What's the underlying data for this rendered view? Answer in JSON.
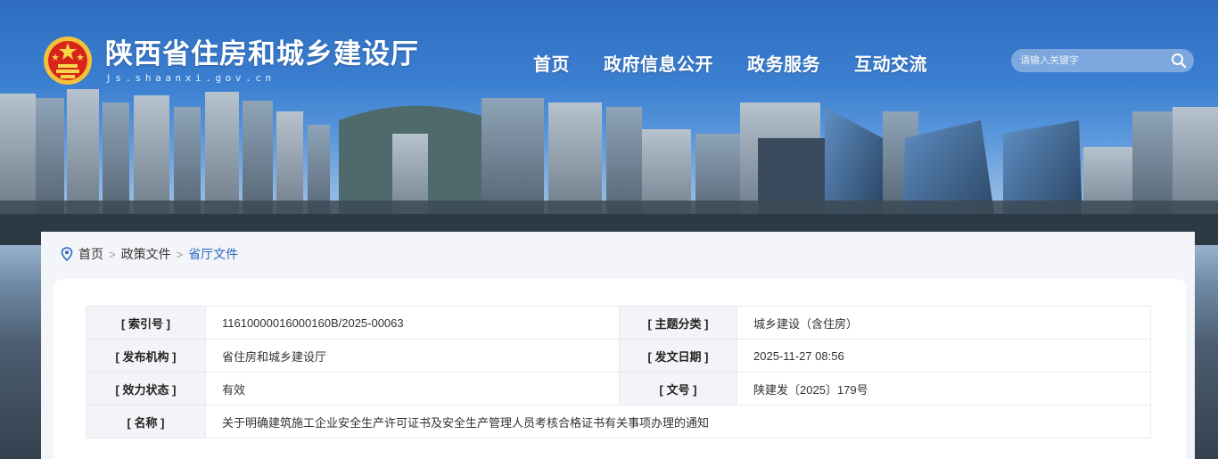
{
  "header": {
    "title_cn": "陕西省住房和城乡建设厅",
    "title_en": "js.shaanxi.gov.cn",
    "emblem_icon": "national-emblem-icon"
  },
  "nav": {
    "items": [
      {
        "label": "首页"
      },
      {
        "label": "政府信息公开"
      },
      {
        "label": "政务服务"
      },
      {
        "label": "互动交流"
      }
    ]
  },
  "search": {
    "placeholder": "请输入关键字",
    "icon": "search-icon"
  },
  "breadcrumb": {
    "icon": "location-pin-icon",
    "items": [
      "首页",
      "政策文件",
      "省厅文件"
    ],
    "separator": ">"
  },
  "document_info": {
    "index_label": "[ 索引号 ]",
    "index_value": "11610000016000160B/2025-00063",
    "category_label": "[ 主题分类 ]",
    "category_value": "城乡建设（含住房）",
    "publisher_label": "[ 发布机构 ]",
    "publisher_value": "省住房和城乡建设厅",
    "date_label": "[ 发文日期 ]",
    "date_value": "2025-11-27 08:56",
    "status_label": "[ 效力状态 ]",
    "status_value": "有效",
    "doc_no_label": "[ 文号 ]",
    "doc_no_value": "陕建发〔2025〕179号",
    "name_label": "[ 名称 ]",
    "name_value": "关于明确建筑施工企业安全生产许可证书及安全生产管理人员考核合格证书有关事项办理的通知"
  },
  "colors": {
    "accent": "#2a68c4",
    "valid_status": "#3d9a3d",
    "label_bg": "#f2f4f7"
  }
}
